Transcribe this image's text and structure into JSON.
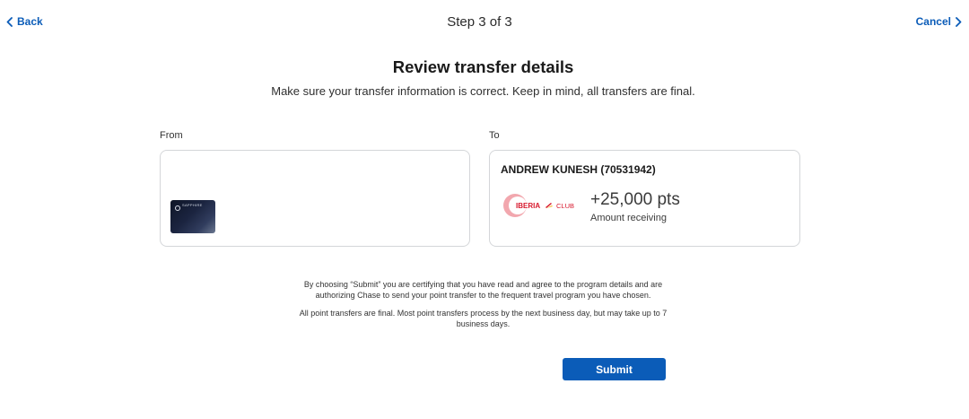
{
  "header": {
    "back_label": "Back",
    "step_label": "Step 3 of 3",
    "cancel_label": "Cancel"
  },
  "main": {
    "title": "Review transfer details",
    "subtitle": "Make sure your transfer information is correct. Keep in mind, all transfers are final."
  },
  "from": {
    "label": "From",
    "card_text": "SAPPHIRE"
  },
  "to": {
    "label": "To",
    "account_name": "ANDREW KUNESH (70531942)",
    "partner_logo_text": "IBERIA",
    "partner_logo_club": "CLUB",
    "points": "+25,000 pts",
    "points_caption": "Amount receiving"
  },
  "disclaimers": [
    "By choosing “Submit” you are certifying that you have read and agree to the program details and are authorizing Chase to send your point transfer to the frequent travel program you have chosen.",
    "All point transfers are final. Most point transfers process by the next business day, but may take up to 7 business days."
  ],
  "submit_label": "Submit",
  "colors": {
    "accent": "#0b5cb8",
    "partner_red": "#d7192d",
    "border": "#d4d6d9"
  },
  "icons": {
    "back": "chevron-left-icon",
    "cancel": "chevron-right-icon"
  }
}
